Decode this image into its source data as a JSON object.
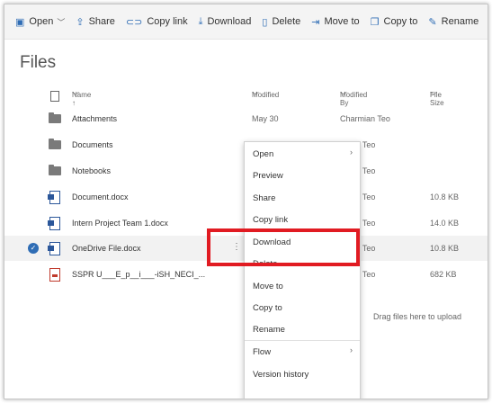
{
  "toolbar": {
    "items": [
      {
        "icon": "open-icon",
        "label": "Open",
        "has_chevron": true
      },
      {
        "icon": "share-icon",
        "label": "Share"
      },
      {
        "icon": "copy-link-icon",
        "label": "Copy link"
      },
      {
        "icon": "download-icon",
        "label": "Download"
      },
      {
        "icon": "delete-icon",
        "label": "Delete"
      },
      {
        "icon": "move-to-icon",
        "label": "Move to"
      },
      {
        "icon": "copy-to-icon",
        "label": "Copy to"
      },
      {
        "icon": "rename-icon",
        "label": "Rename"
      },
      {
        "icon": "flow-icon",
        "label": ""
      }
    ]
  },
  "page_title": "Files",
  "table": {
    "headers": {
      "name": "Name ↑",
      "modified": "Modified",
      "modified_by": "Modified By",
      "file_size": "File Size"
    },
    "rows": [
      {
        "type": "folder",
        "name": "Attachments",
        "modified": "May 30",
        "modified_by": "Charmian Teo",
        "size": ""
      },
      {
        "type": "folder",
        "name": "Documents",
        "modified": "",
        "modified_by": "rmian Teo",
        "size": ""
      },
      {
        "type": "folder",
        "name": "Notebooks",
        "modified": "",
        "modified_by": "rmian Teo",
        "size": ""
      },
      {
        "type": "doc",
        "name": "Document.docx",
        "modified": "",
        "modified_by": "rmian Teo",
        "size": "10.8 KB"
      },
      {
        "type": "doc",
        "name": "Intern Project Team 1.docx",
        "modified": "",
        "modified_by": "rmian Teo",
        "size": "14.0 KB"
      },
      {
        "type": "doc",
        "name": "OneDrive File.docx",
        "modified": "",
        "modified_by": "rmian Teo",
        "size": "10.8 KB",
        "selected": true
      },
      {
        "type": "pdf",
        "name": "SSPR U___E_p__i___-iSH_NECI_...",
        "modified": "",
        "modified_by": "rmian Teo",
        "size": "682 KB"
      }
    ]
  },
  "drag_hint": "Drag files here to upload",
  "context_menu": {
    "items": [
      "Open",
      "Preview",
      "Share",
      "Copy link",
      "Download",
      "Delete",
      "Move to",
      "Copy to",
      "Rename",
      "Flow",
      "Version history"
    ]
  },
  "colors": {
    "accent": "#2f6db5",
    "highlight": "#e11b22",
    "selected_row": "#f2f2f2"
  }
}
